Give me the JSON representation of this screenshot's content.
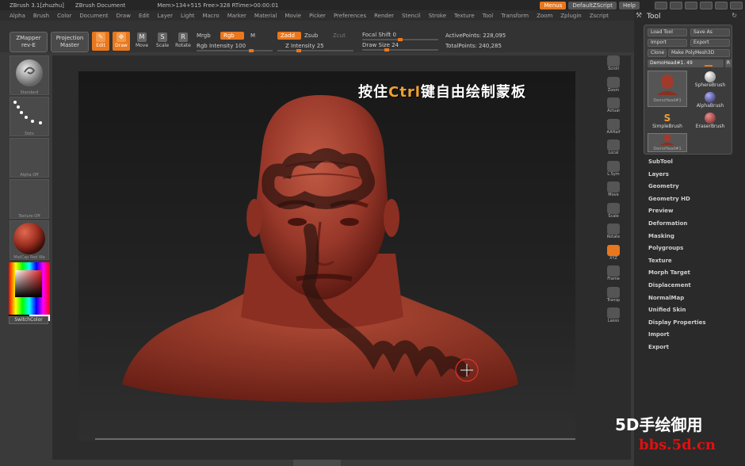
{
  "titlebar": {
    "app": "ZBrush 3.1[zhuzhu]",
    "document": "ZBrush Document",
    "mem": "Mem>134+515 Free>328 RTime>00:00:01",
    "menus_label": "Menus",
    "script_label": "DefaultZScript",
    "help_label": "Help"
  },
  "menubar": {
    "items": [
      "Alpha",
      "Brush",
      "Color",
      "Document",
      "Draw",
      "Edit",
      "Layer",
      "Light",
      "Macro",
      "Marker",
      "Material",
      "Movie",
      "Picker",
      "Preferences",
      "Render",
      "Stencil",
      "Stroke",
      "Texture",
      "Tool",
      "Transform",
      "Zoom",
      "Zplugin",
      "Zscript"
    ]
  },
  "shelf": {
    "zmapper_line1": "ZMapper",
    "zmapper_line2": "rev-E",
    "projection_line1": "Projection",
    "projection_line2": "Master",
    "edit_label": "Edit",
    "draw_label": "Draw",
    "move_label": "Move",
    "scale_label": "Scale",
    "rotate_label": "Rotate",
    "mrgb_label": "Mrgb",
    "rgb_label": "Rgb",
    "m_label": "M",
    "rgb_intensity_label": "Rgb Intensity 100",
    "zadd_label": "Zadd",
    "zsub_label": "Zsub",
    "zcut_label": "Zcut",
    "z_intensity_label": "Z Intensity 25",
    "focal_shift_label": "Focal Shift 0",
    "draw_size_label": "Draw Size 24",
    "active_points": "ActivePoints: 228,095",
    "total_points": "TotalPoints: 240,285"
  },
  "leftpanel": {
    "standard_label": "Standard",
    "dots_label": "Dots",
    "alpha_label": "Alpha  Off",
    "texture_label": "Texture  Off",
    "matcap_label": "MatCap  Red  Wa",
    "switchcolor_label": "SwitchColor"
  },
  "overlay": {
    "title_before": "按住",
    "title_ctrl": "Ctrl",
    "title_after": "键自由绘制蒙板"
  },
  "rightdock": {
    "items": [
      "Scroll",
      "Zoom",
      "Actual",
      "AAHalf",
      "Local",
      "L.Sym",
      "Move",
      "Scale",
      "Rotate",
      "XYZ",
      "Frame",
      "Transp",
      "Lasso"
    ]
  },
  "toolpanel": {
    "title": "Tool",
    "load_tool": "Load Tool",
    "save_as": "Save As",
    "import": "Import",
    "export": "Export",
    "clone": "Clone",
    "make_polymesh": "Make PolyMesh3D",
    "current_tool": "DemoHead#1. 49",
    "r_label": "R",
    "brushes": [
      "DemoHead#1",
      "SphereBrush",
      "AlphaBrush",
      "SimpleBrush",
      "EraserBrush",
      "DemoHead#1"
    ],
    "subpalettes": [
      "SubTool",
      "Layers",
      "Geometry",
      "Geometry HD",
      "Preview",
      "Deformation",
      "Masking",
      "Polygroups",
      "Texture",
      "Morph Target",
      "Displacement",
      "NormalMap",
      "Unified Skin",
      "Display Properties",
      "Import",
      "Export"
    ]
  },
  "watermark": {
    "line1": "5D手绘御用",
    "line2": "bbs.5d.cn"
  },
  "colors": {
    "accent": "#e8771e",
    "clay": "#a23a2c"
  }
}
